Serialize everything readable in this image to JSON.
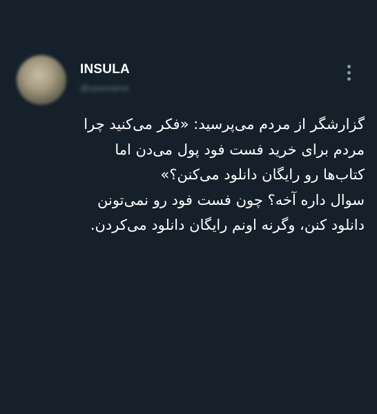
{
  "tweet": {
    "author_name": "INSULA",
    "author_handle": "@username",
    "more_icon": "more-vertical-icon",
    "body_lines": [
      "گزارشگر از مردم می‌پرسید: «فکر می‌کنید چرا",
      "مردم برای خرید فست فود پول می‌دن اما",
      "کتاب‌ها رو رایگان دانلود می‌کنن؟»",
      "سوال داره آخه؟ چون فست فود رو نمی‌تونن",
      "دانلود کنن، وگرنه اونم رایگان دانلود می‌کردن."
    ]
  },
  "colors": {
    "background": "#15202b",
    "text": "#ffffff",
    "secondary": "#8b98a5"
  }
}
